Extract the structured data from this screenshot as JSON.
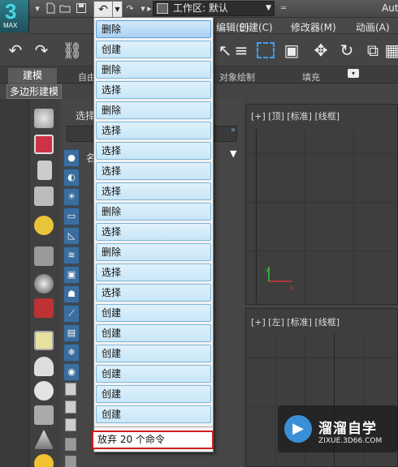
{
  "app": {
    "logo_text": "3",
    "logo_sub": "MAX",
    "title_partial": "Aut",
    "workspace_label": "工作区: 默认"
  },
  "menu": {
    "items": [
      "编辑(E)",
      "创建(C)",
      "修改器(M)",
      "动画(A)"
    ]
  },
  "ribbon": {
    "tabs": [
      "建模",
      "自由",
      "对象绘制",
      "填充"
    ],
    "subtab": "多边形建模"
  },
  "command_panel": {
    "label": "选择",
    "name_label": "名"
  },
  "viewports": {
    "top_label": "[+] [顶] [标准] [线框]",
    "left_label": "[+] [左] [标准] [线框]"
  },
  "undo_dropdown": {
    "items": [
      "删除",
      "创建",
      "删除",
      "选择",
      "删除",
      "选择",
      "选择",
      "选择",
      "选择",
      "删除",
      "选择",
      "删除",
      "选择",
      "选择",
      "创建",
      "创建",
      "创建",
      "创建",
      "创建",
      "创建"
    ],
    "status": "放弃 20 个命令"
  },
  "watermark": {
    "logo_glyph": "▶",
    "title": "溜溜自学",
    "subtitle": "ZIXUE.3D66.COM"
  },
  "colors": {
    "selection_blue": "#3aa0ff",
    "status_border": "#d21f1f",
    "item_bg": "#c8e6f7"
  }
}
